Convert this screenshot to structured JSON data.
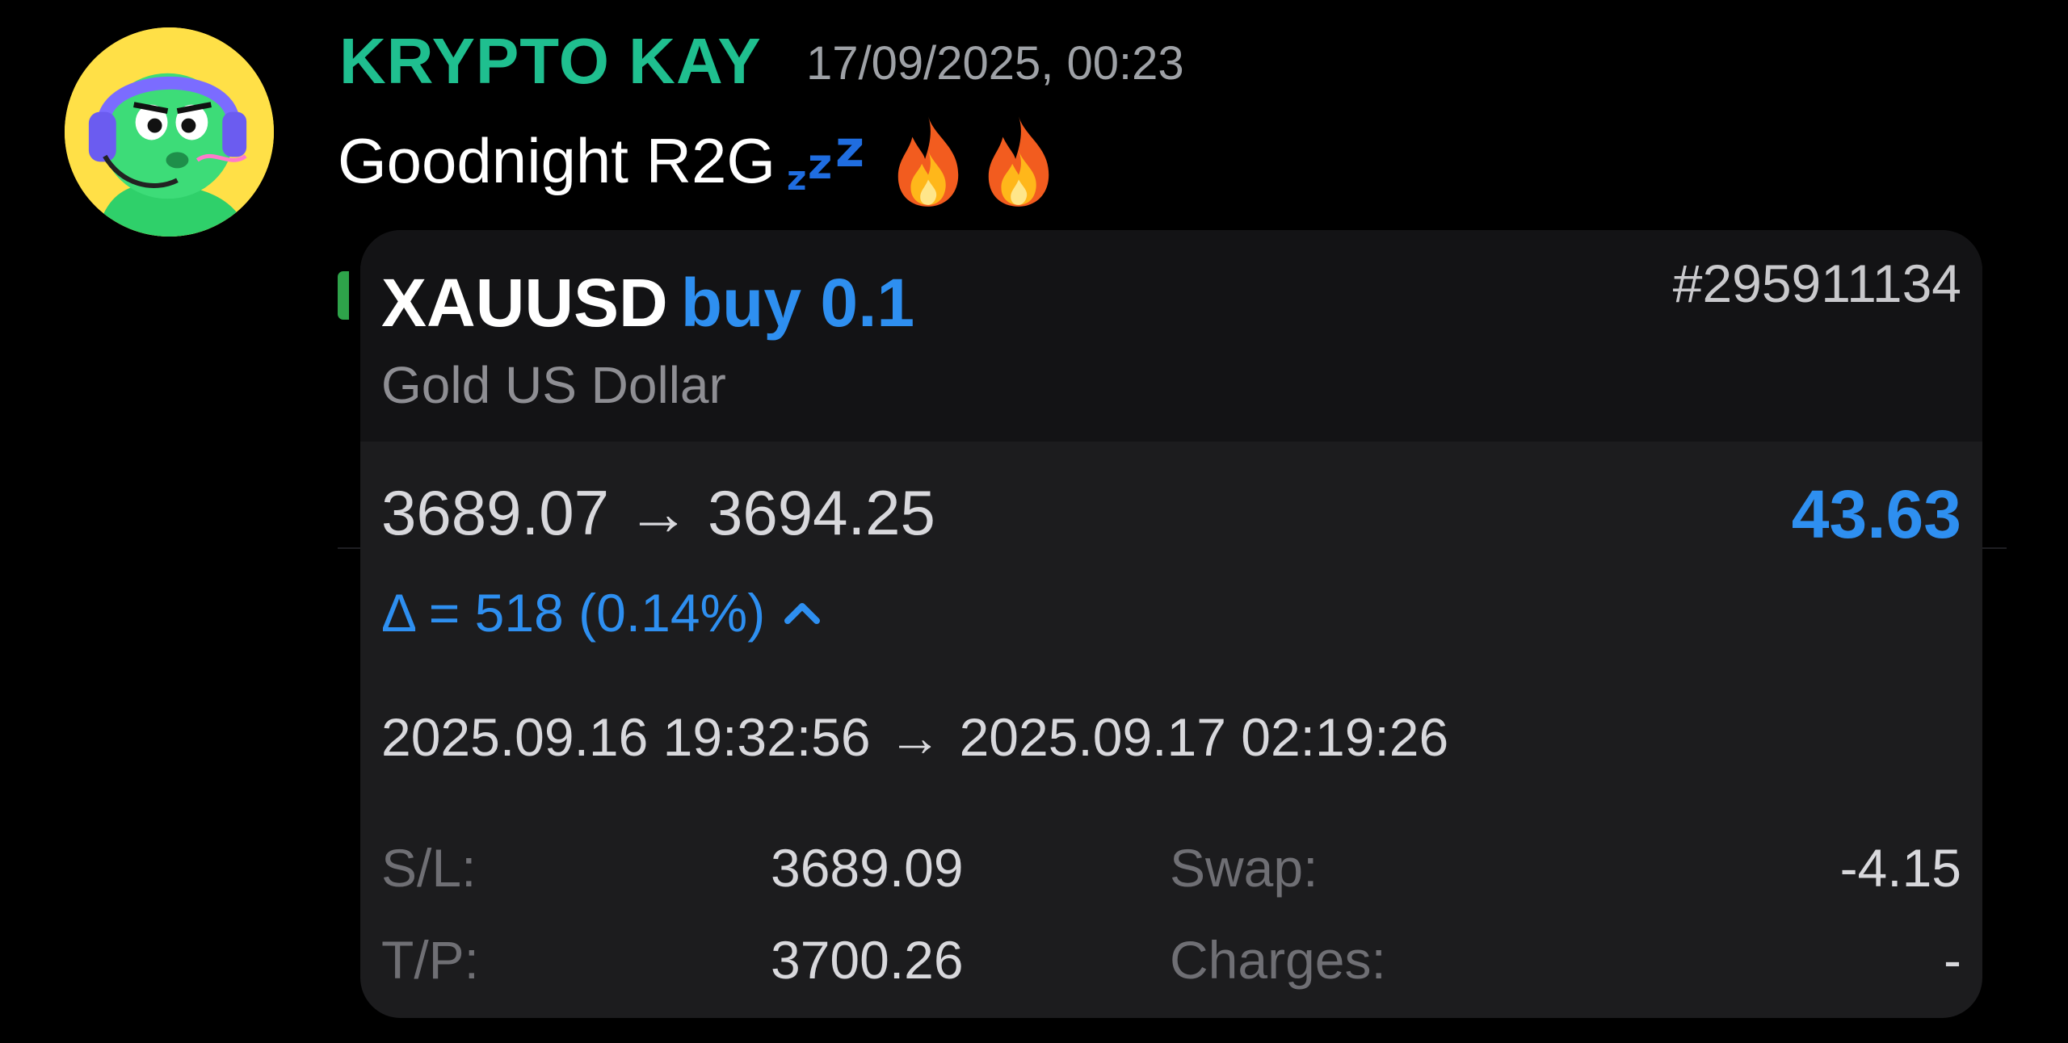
{
  "message": {
    "author": "KRYPTO KAY",
    "timestamp": "17/09/2025, 00:23",
    "text": "Goodnight R2G",
    "zzz_glyph": "z",
    "avatar_icon": "green-creature-headset-avatar",
    "emoji": [
      "fire-icon",
      "fire-icon"
    ]
  },
  "trade": {
    "symbol": "XAUUSD",
    "side_volume": "buy 0.1",
    "ticket": "#295911134",
    "description": "Gold US Dollar",
    "open_price": "3689.07",
    "close_price": "3694.25",
    "profit": "43.63",
    "delta": "Δ = 518 (0.14%)",
    "open_time": "2025.09.16 19:32:56",
    "close_time": "2025.09.17 02:19:26",
    "arrow": "→",
    "sl_label": "S/L:",
    "sl_value": "3689.09",
    "tp_label": "T/P:",
    "tp_value": "3700.26",
    "swap_label": "Swap:",
    "swap_value": "-4.15",
    "charges_label": "Charges:",
    "charges_value": "-"
  },
  "colors": {
    "author": "#1fbf8f",
    "accent_blue": "#2e8ff0",
    "card_bg": "#1c1c1e",
    "card_header_bg": "#131315"
  }
}
